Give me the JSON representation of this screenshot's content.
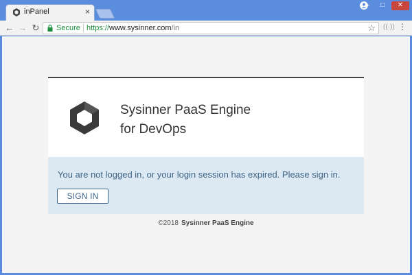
{
  "browser": {
    "tab_title": "inPanel",
    "tab_close": "×",
    "security_label": "Secure",
    "url_scheme": "https://",
    "url_host": "www.sysinner.com",
    "url_path": "/in"
  },
  "icons": {
    "back": "←",
    "forward": "→",
    "reload": "↻",
    "star": "☆",
    "menu": "⋮",
    "extension": "((·))",
    "minimize": "–",
    "maximize": "□",
    "close": "✕"
  },
  "page": {
    "brand_line1": "Sysinner PaaS Engine",
    "brand_line2": "for DevOps",
    "message": "You are not logged in, or your login session has expired. Please sign in.",
    "signin_label": "SIGN IN",
    "footer_copyright": "©2018",
    "footer_name": "Sysinner PaaS Engine"
  },
  "colors": {
    "secure_green": "#1e8e3e",
    "message_text": "#3d6487",
    "message_bg": "#dde9f2"
  }
}
